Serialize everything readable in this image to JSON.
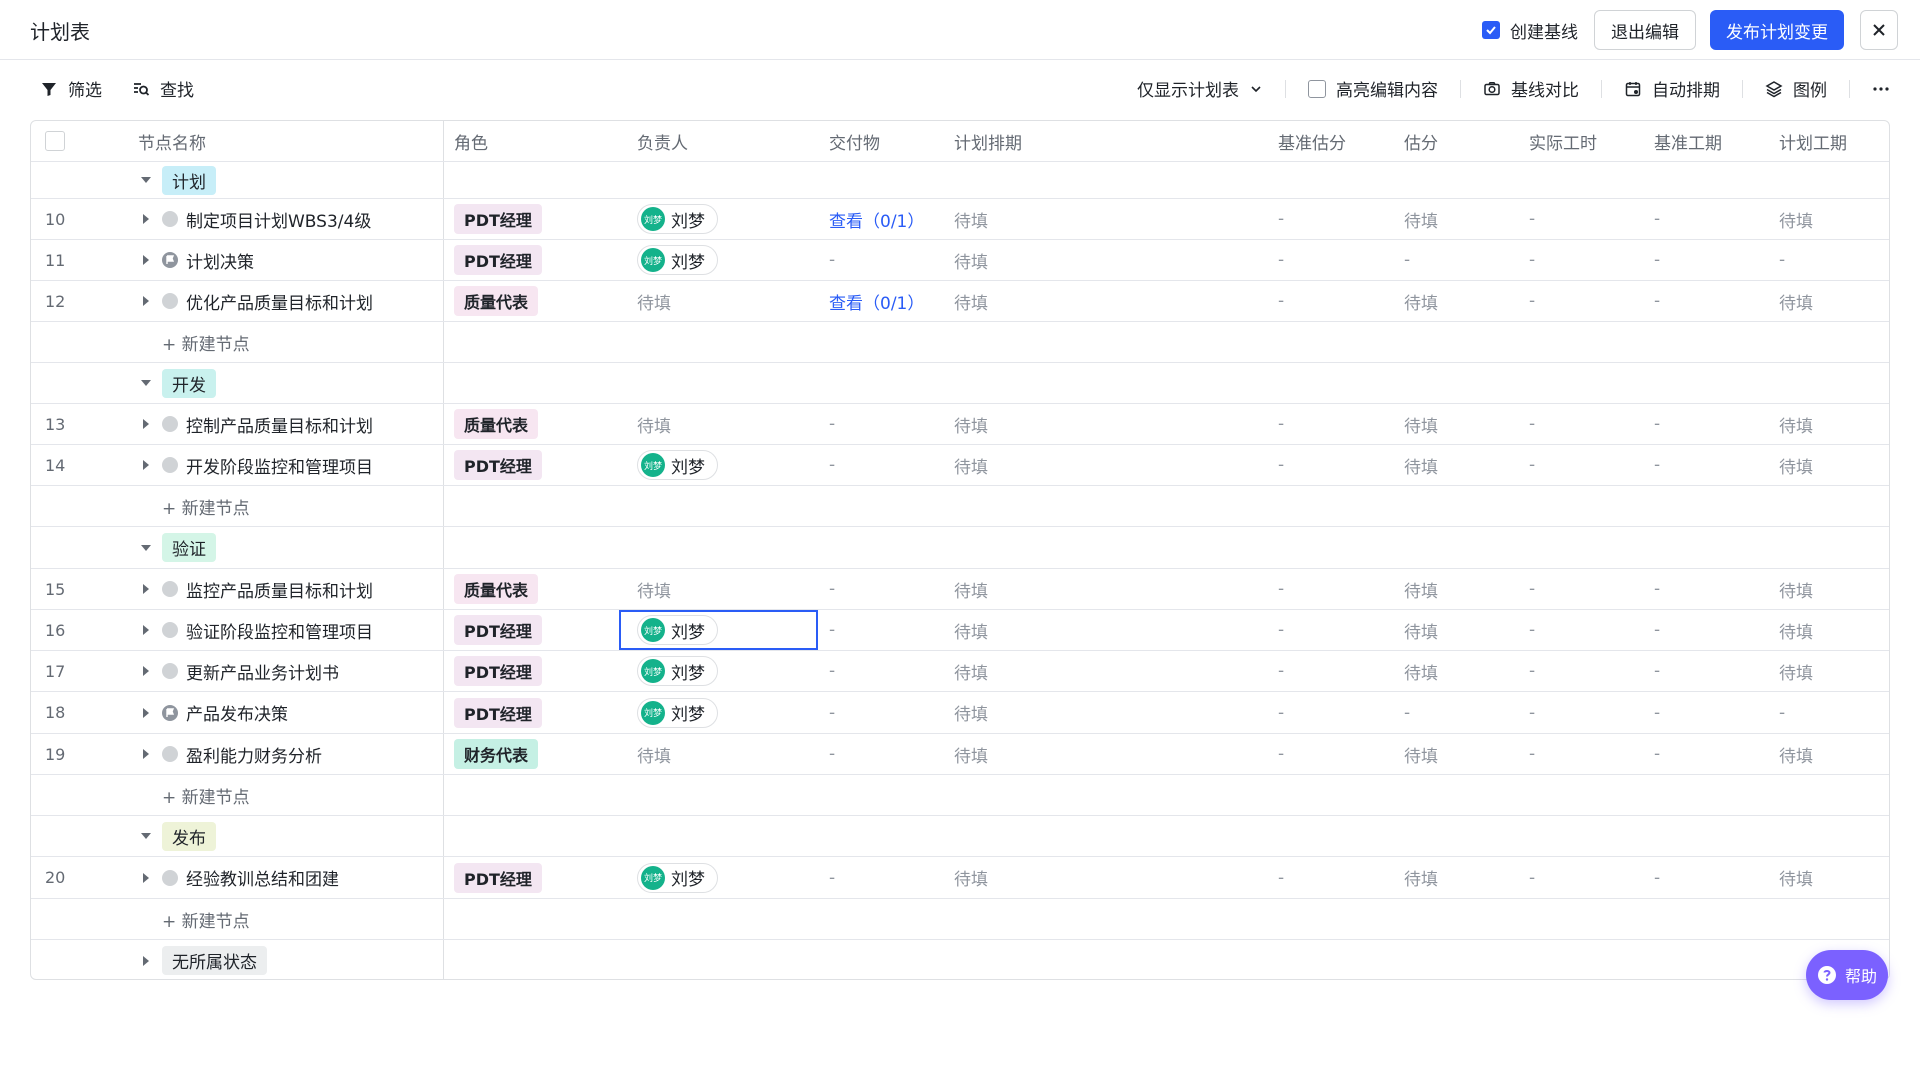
{
  "header": {
    "title": "计划表",
    "create_baseline_label": "创建基线",
    "exit_edit_label": "退出编辑",
    "publish_label": "发布计划变更"
  },
  "toolbar": {
    "filter_label": "筛选",
    "find_label": "查找",
    "view_select_label": "仅显示计划表",
    "highlight_label": "高亮编辑内容",
    "baseline_compare_label": "基线对比",
    "auto_schedule_label": "自动排期",
    "legend_label": "图例"
  },
  "columns": {
    "name": "节点名称",
    "role": "角色",
    "owner": "负责人",
    "deliverable": "交付物",
    "schedule": "计划排期",
    "baseline_estimate": "基准估分",
    "estimate": "估分",
    "actual_hours": "实际工时",
    "baseline_duration": "基准工期",
    "planned_duration": "计划工期"
  },
  "groups": {
    "plan": "计划",
    "dev": "开发",
    "verify": "验证",
    "release": "发布",
    "none": "无所属状态"
  },
  "new_node_label": "+ 新建节点",
  "avatar_text": "刘梦",
  "rows": {
    "r10": {
      "num": "10",
      "name": "制定项目计划WBS3/4级",
      "role": "PDT经理",
      "owner": "刘梦",
      "deliverable": "查看（0/1）",
      "schedule": "待填",
      "base_est": "-",
      "est": "待填",
      "actual": "-",
      "base_dur": "-",
      "plan_dur": "待填"
    },
    "r11": {
      "num": "11",
      "name": "计划决策",
      "role": "PDT经理",
      "owner": "刘梦",
      "deliverable": "-",
      "schedule": "待填",
      "base_est": "-",
      "est": "-",
      "actual": "-",
      "base_dur": "-",
      "plan_dur": "-"
    },
    "r12": {
      "num": "12",
      "name": "优化产品质量目标和计划",
      "role": "质量代表",
      "owner": "待填",
      "deliverable": "查看（0/1）",
      "schedule": "待填",
      "base_est": "-",
      "est": "待填",
      "actual": "-",
      "base_dur": "-",
      "plan_dur": "待填"
    },
    "r13": {
      "num": "13",
      "name": "控制产品质量目标和计划",
      "role": "质量代表",
      "owner": "待填",
      "deliverable": "-",
      "schedule": "待填",
      "base_est": "-",
      "est": "待填",
      "actual": "-",
      "base_dur": "-",
      "plan_dur": "待填"
    },
    "r14": {
      "num": "14",
      "name": "开发阶段监控和管理项目",
      "role": "PDT经理",
      "owner": "刘梦",
      "deliverable": "-",
      "schedule": "待填",
      "base_est": "-",
      "est": "待填",
      "actual": "-",
      "base_dur": "-",
      "plan_dur": "待填"
    },
    "r15": {
      "num": "15",
      "name": "监控产品质量目标和计划",
      "role": "质量代表",
      "owner": "待填",
      "deliverable": "-",
      "schedule": "待填",
      "base_est": "-",
      "est": "待填",
      "actual": "-",
      "base_dur": "-",
      "plan_dur": "待填"
    },
    "r16": {
      "num": "16",
      "name": "验证阶段监控和管理项目",
      "role": "PDT经理",
      "owner": "刘梦",
      "deliverable": "-",
      "schedule": "待填",
      "base_est": "-",
      "est": "待填",
      "actual": "-",
      "base_dur": "-",
      "plan_dur": "待填"
    },
    "r17": {
      "num": "17",
      "name": "更新产品业务计划书",
      "role": "PDT经理",
      "owner": "刘梦",
      "deliverable": "-",
      "schedule": "待填",
      "base_est": "-",
      "est": "待填",
      "actual": "-",
      "base_dur": "-",
      "plan_dur": "待填"
    },
    "r18": {
      "num": "18",
      "name": "产品发布决策",
      "role": "PDT经理",
      "owner": "刘梦",
      "deliverable": "-",
      "schedule": "待填",
      "base_est": "-",
      "est": "-",
      "actual": "-",
      "base_dur": "-",
      "plan_dur": "-"
    },
    "r19": {
      "num": "19",
      "name": "盈利能力财务分析",
      "role": "财务代表",
      "owner": "待填",
      "deliverable": "-",
      "schedule": "待填",
      "base_est": "-",
      "est": "待填",
      "actual": "-",
      "base_dur": "-",
      "plan_dur": "待填"
    },
    "r20": {
      "num": "20",
      "name": "经验教训总结和团建",
      "role": "PDT经理",
      "owner": "刘梦",
      "deliverable": "-",
      "schedule": "待填",
      "base_est": "-",
      "est": "待填",
      "actual": "-",
      "base_dur": "-",
      "plan_dur": "待填"
    }
  },
  "help_label": "帮助",
  "colors": {
    "primary": "#2a5cf6",
    "avatar": "#14b28b",
    "help": "#7b61ff",
    "group_plan": "#c7eef8",
    "group_dev": "#c9f1ee",
    "group_verify": "#d4f5e7",
    "group_release": "#eef3d8",
    "group_none": "#eceeef"
  }
}
